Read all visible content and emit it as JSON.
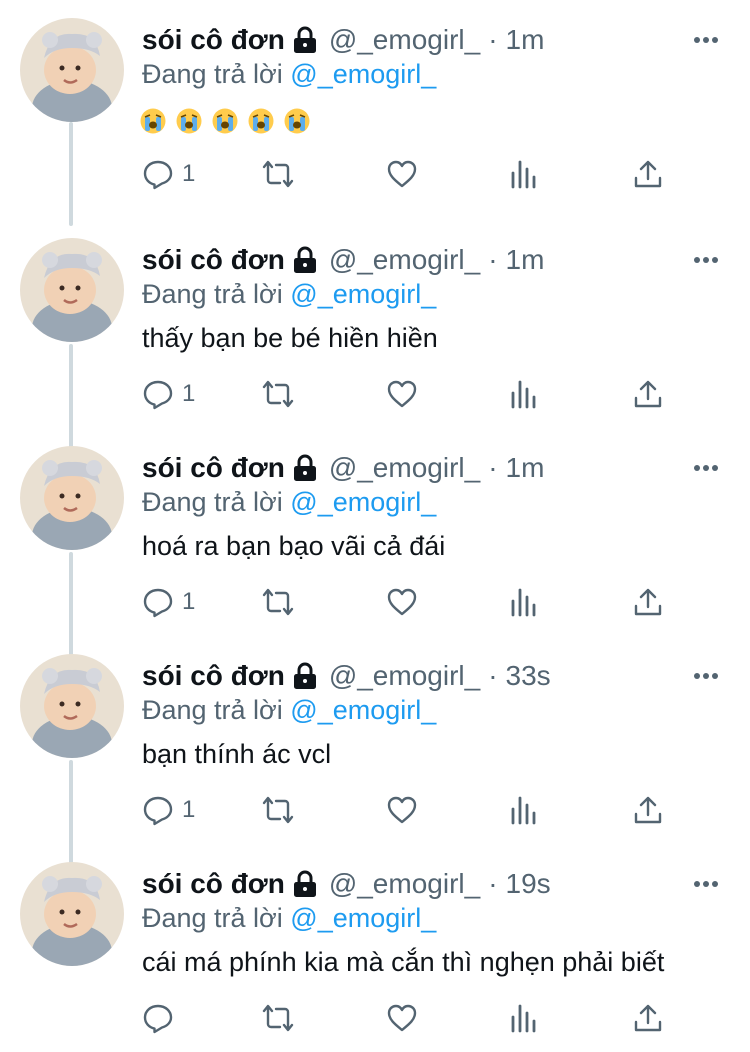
{
  "colors": {
    "accent": "#1d9bf0",
    "secondary_text": "#536471",
    "primary_text": "#0f1419",
    "thread_line": "#cfd9de"
  },
  "tweets": [
    {
      "display_name": "sói cô đơn",
      "handle": "@_emogirl_",
      "separator": "·",
      "time": "1m",
      "reply_prefix": "Đang trả lời",
      "reply_mention": "@_emogirl_",
      "text": "",
      "emojis": [
        "loudly-crying-face",
        "loudly-crying-face",
        "loudly-crying-face",
        "loudly-crying-face",
        "loudly-crying-face"
      ],
      "reply_count": "1"
    },
    {
      "display_name": "sói cô đơn",
      "handle": "@_emogirl_",
      "separator": "·",
      "time": "1m",
      "reply_prefix": "Đang trả lời",
      "reply_mention": "@_emogirl_",
      "text": "thấy bạn be bé hiền hiền",
      "reply_count": "1"
    },
    {
      "display_name": "sói cô đơn",
      "handle": "@_emogirl_",
      "separator": "·",
      "time": "1m",
      "reply_prefix": "Đang trả lời",
      "reply_mention": "@_emogirl_",
      "text": "hoá ra bạn bạo vãi cả đái",
      "reply_count": "1"
    },
    {
      "display_name": "sói cô đơn",
      "handle": "@_emogirl_",
      "separator": "·",
      "time": "33s",
      "reply_prefix": "Đang trả lời",
      "reply_mention": "@_emogirl_",
      "text": "bạn thính ác vcl",
      "reply_count": "1"
    },
    {
      "display_name": "sói cô đơn",
      "handle": "@_emogirl_",
      "separator": "·",
      "time": "19s",
      "reply_prefix": "Đang trả lời",
      "reply_mention": "@_emogirl_",
      "text": "cái má phính kia mà cắn thì nghẹn phải biết",
      "reply_count": ""
    }
  ]
}
